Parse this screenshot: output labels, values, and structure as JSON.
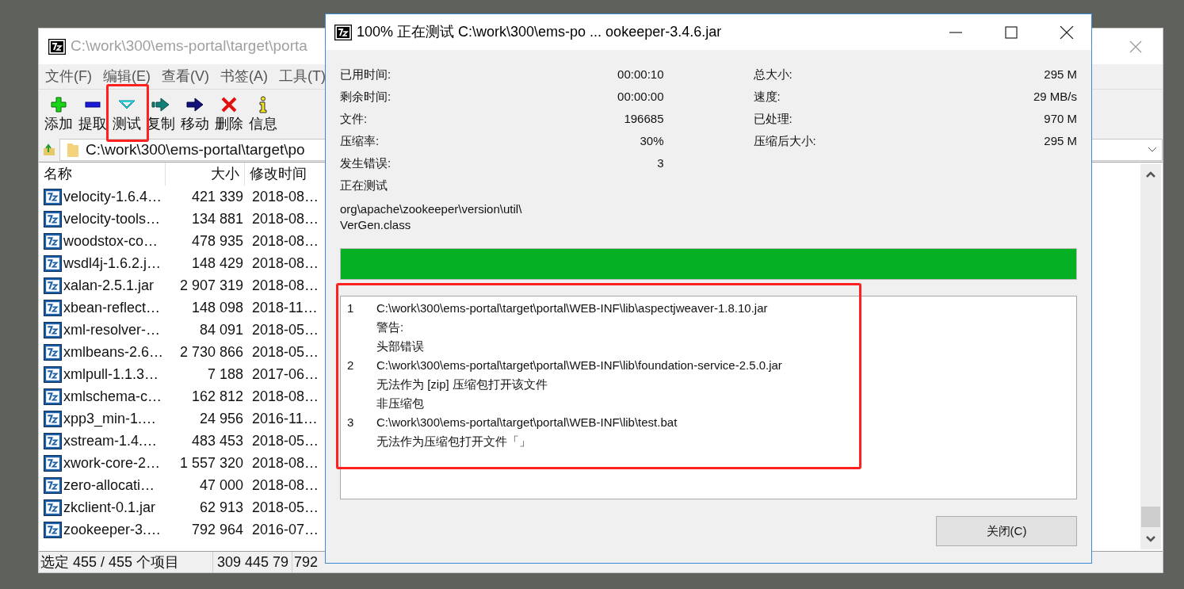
{
  "main_window": {
    "title": "C:\\work\\300\\ems-portal\\target\\porta",
    "menu": [
      "文件(F)",
      "编辑(E)",
      "查看(V)",
      "书签(A)",
      "工具(T)"
    ],
    "toolbar": [
      {
        "label": "添加",
        "kind": "add"
      },
      {
        "label": "提取",
        "kind": "extract"
      },
      {
        "label": "测试",
        "kind": "test"
      },
      {
        "label": "复制",
        "kind": "copy"
      },
      {
        "label": "移动",
        "kind": "move"
      },
      {
        "label": "删除",
        "kind": "delete"
      },
      {
        "label": "信息",
        "kind": "info"
      }
    ],
    "address": "C:\\work\\300\\ems-portal\\target\\po",
    "columns": [
      "名称",
      "大小",
      "修改时间"
    ],
    "files": [
      {
        "name": "velocity-1.6.4…",
        "size": "421 339",
        "modified": "2018-08…"
      },
      {
        "name": "velocity-tools…",
        "size": "134 881",
        "modified": "2018-08…"
      },
      {
        "name": "woodstox-co…",
        "size": "478 935",
        "modified": "2018-08…"
      },
      {
        "name": "wsdl4j-1.6.2.j…",
        "size": "148 429",
        "modified": "2018-08…"
      },
      {
        "name": "xalan-2.5.1.jar",
        "size": "2 907 319",
        "modified": "2018-08…"
      },
      {
        "name": "xbean-reflect…",
        "size": "148 098",
        "modified": "2018-11…"
      },
      {
        "name": "xml-resolver-…",
        "size": "84 091",
        "modified": "2018-05…"
      },
      {
        "name": "xmlbeans-2.6…",
        "size": "2 730 866",
        "modified": "2018-05…"
      },
      {
        "name": "xmlpull-1.1.3…",
        "size": "7 188",
        "modified": "2017-06…"
      },
      {
        "name": "xmlschema-c…",
        "size": "162 812",
        "modified": "2018-08…"
      },
      {
        "name": "xpp3_min-1.…",
        "size": "24 956",
        "modified": "2016-11…"
      },
      {
        "name": "xstream-1.4.…",
        "size": "483 453",
        "modified": "2018-05…"
      },
      {
        "name": "xwork-core-2…",
        "size": "1 557 320",
        "modified": "2018-08…"
      },
      {
        "name": "zero-allocati…",
        "size": "47 000",
        "modified": "2018-08…"
      },
      {
        "name": "zkclient-0.1.jar",
        "size": "62 913",
        "modified": "2018-05…"
      },
      {
        "name": "zookeeper-3.…",
        "size": "792 964",
        "modified": "2016-07…"
      }
    ],
    "status": [
      "选定 455 / 455 个项目",
      "309 445 79",
      "792"
    ]
  },
  "dialog": {
    "title": "100% 正在测试 C:\\work\\300\\ems-po ... ookeeper-3.4.6.jar",
    "stats_left": [
      {
        "label": "已用时间:",
        "value": "00:00:10"
      },
      {
        "label": "剩余时间:",
        "value": "00:00:00"
      },
      {
        "label": "文件:",
        "value": "196685"
      },
      {
        "label": "压缩率:",
        "value": "30%"
      },
      {
        "label": "发生错误:",
        "value": "3"
      }
    ],
    "stats_right": [
      {
        "label": "总大小:",
        "value": "295 M"
      },
      {
        "label": "速度:",
        "value": "29 MB/s"
      },
      {
        "label": "已处理:",
        "value": "970 M"
      },
      {
        "label": "压缩后大小:",
        "value": "295 M"
      }
    ],
    "state_text": "正在测试",
    "current_file": [
      "org\\apache\\zookeeper\\version\\util\\",
      "VerGen.class"
    ],
    "progress": {
      "level": 1
    },
    "log": [
      {
        "number": "1",
        "lines": [
          "C:\\work\\300\\ems-portal\\target\\portal\\WEB-INF\\lib\\aspectjweaver-1.8.10.jar",
          "警告:",
          "头部错误"
        ]
      },
      {
        "number": "2",
        "lines": [
          "C:\\work\\300\\ems-portal\\target\\portal\\WEB-INF\\lib\\foundation-service-2.5.0.jar",
          "无法作为 [zip] 压缩包打开该文件",
          "非压缩包"
        ]
      },
      {
        "number": "3",
        "lines": [
          "C:\\work\\300\\ems-portal\\target\\portal\\WEB-INF\\lib\\test.bat",
          "无法作为压缩包打开文件「」"
        ]
      }
    ],
    "close_button": "关闭(C)"
  }
}
